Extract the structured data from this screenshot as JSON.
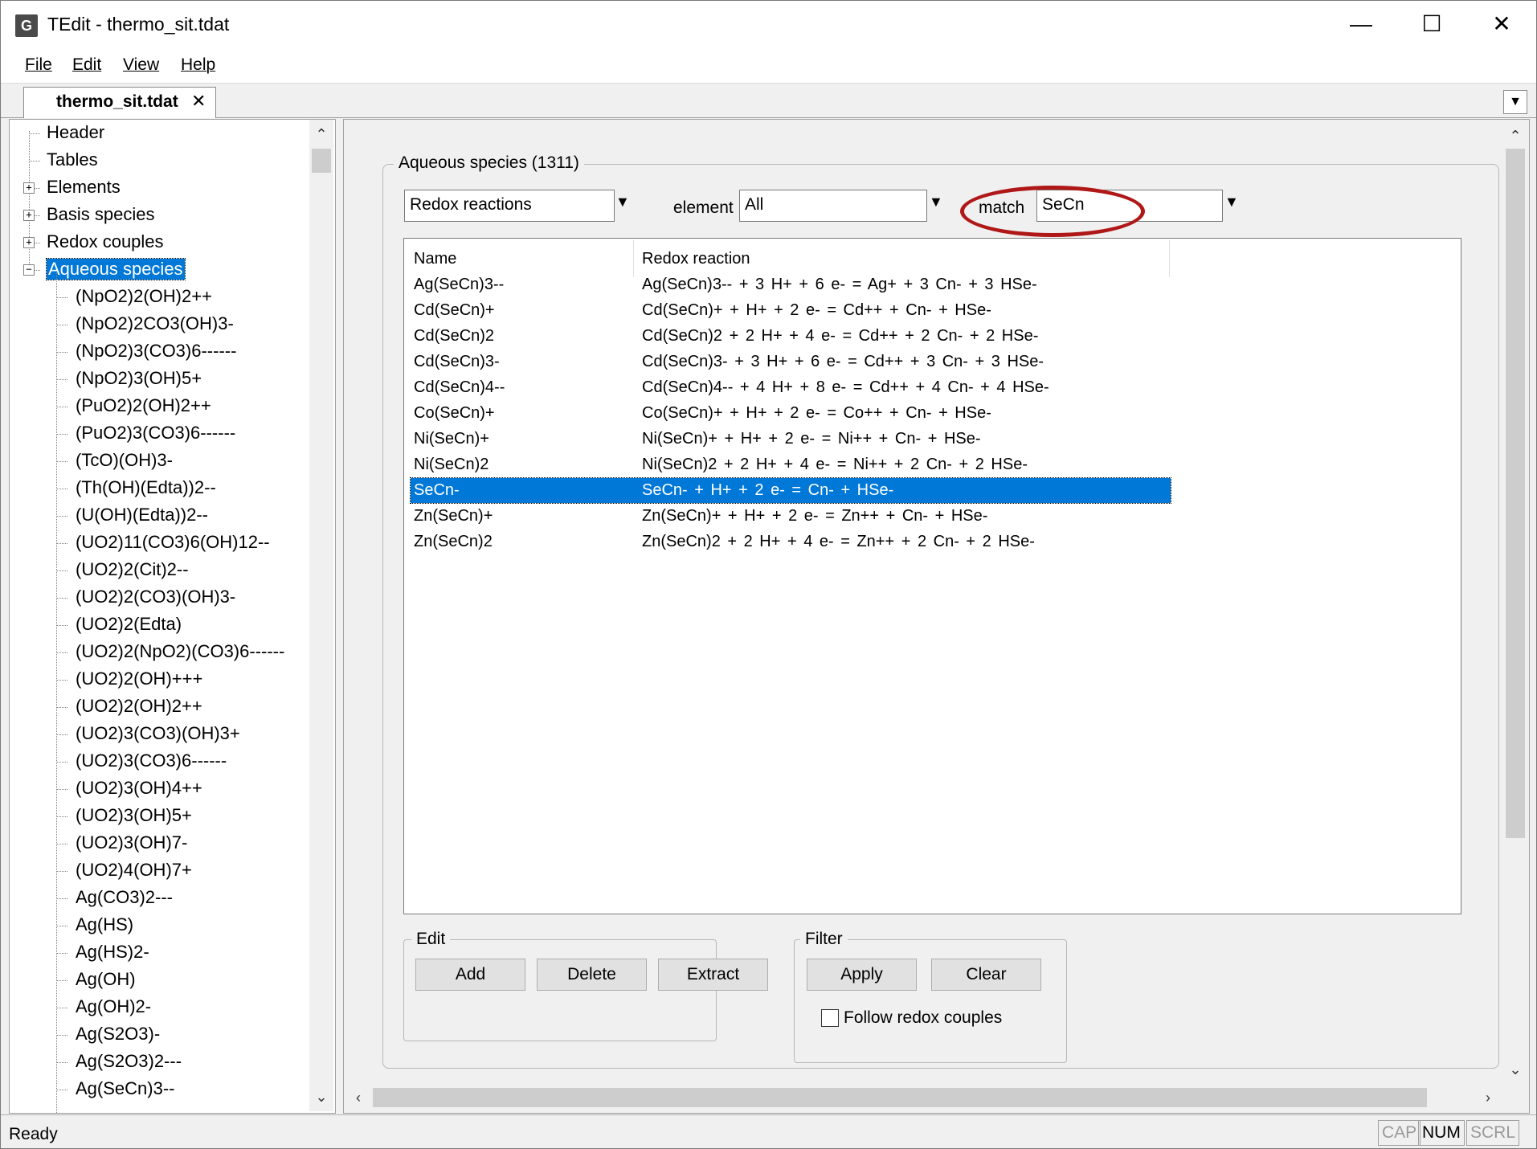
{
  "window": {
    "title": "TEdit - thermo_sit.tdat",
    "icon": "G",
    "minimize_glyph": "—",
    "maximize_glyph": "☐",
    "close_glyph": "✕"
  },
  "menu": [
    "File",
    "Edit",
    "View",
    "Help"
  ],
  "tab": {
    "label": "thermo_sit.tdat",
    "close_glyph": "✕"
  },
  "tree": {
    "top_items": [
      {
        "label": "Header",
        "expander": ""
      },
      {
        "label": "Tables",
        "expander": ""
      },
      {
        "label": "Elements",
        "expander": "+"
      },
      {
        "label": "Basis species",
        "expander": "+"
      },
      {
        "label": "Redox couples",
        "expander": "+"
      },
      {
        "label": "Aqueous species",
        "expander": "−",
        "selected": true
      }
    ],
    "children": [
      "(NpO2)2(OH)2++",
      "(NpO2)2CO3(OH)3-",
      "(NpO2)3(CO3)6------",
      "(NpO2)3(OH)5+",
      "(PuO2)2(OH)2++",
      "(PuO2)3(CO3)6------",
      "(TcO)(OH)3-",
      "(Th(OH)(Edta))2--",
      "(U(OH)(Edta))2--",
      "(UO2)11(CO3)6(OH)12--",
      "(UO2)2(Cit)2--",
      "(UO2)2(CO3)(OH)3-",
      "(UO2)2(Edta)",
      "(UO2)2(NpO2)(CO3)6------",
      "(UO2)2(OH)+++",
      "(UO2)2(OH)2++",
      "(UO2)3(CO3)(OH)3+",
      "(UO2)3(CO3)6------",
      "(UO2)3(OH)4++",
      "(UO2)3(OH)5+",
      "(UO2)3(OH)7-",
      "(UO2)4(OH)7+",
      "Ag(CO3)2---",
      "Ag(HS)",
      "Ag(HS)2-",
      "Ag(OH)",
      "Ag(OH)2-",
      "Ag(S2O3)-",
      "Ag(S2O3)2---",
      "Ag(SeCn)3--"
    ]
  },
  "panel": {
    "group_title": "Aqueous species (1311)",
    "view_combo": "Redox reactions",
    "element_label": "element",
    "element_combo": "All",
    "match_label": "match",
    "match_value": "SeCn",
    "highlight_color": "#b01818"
  },
  "table": {
    "columns": [
      "Name",
      "Redox reaction"
    ],
    "rows": [
      {
        "name": "Ag(SeCn)3--",
        "rxn": "Ag(SeCn)3-- + 3 H+ + 6 e- = Ag+ + 3 Cn- + 3 HSe-"
      },
      {
        "name": "Cd(SeCn)+",
        "rxn": "Cd(SeCn)+ + H+ + 2 e- = Cd++ + Cn- + HSe-"
      },
      {
        "name": "Cd(SeCn)2",
        "rxn": "Cd(SeCn)2 + 2 H+ + 4 e- = Cd++ + 2 Cn- + 2 HSe-"
      },
      {
        "name": "Cd(SeCn)3-",
        "rxn": "Cd(SeCn)3- + 3 H+ + 6 e- = Cd++ + 3 Cn- + 3 HSe-"
      },
      {
        "name": "Cd(SeCn)4--",
        "rxn": "Cd(SeCn)4-- + 4 H+ + 8 e- = Cd++ + 4 Cn- + 4 HSe-"
      },
      {
        "name": "Co(SeCn)+",
        "rxn": "Co(SeCn)+ + H+ + 2 e- = Co++ + Cn- + HSe-"
      },
      {
        "name": "Ni(SeCn)+",
        "rxn": "Ni(SeCn)+ + H+ + 2 e- = Ni++ + Cn- + HSe-"
      },
      {
        "name": "Ni(SeCn)2",
        "rxn": "Ni(SeCn)2 + 2 H+ + 4 e- = Ni++ + 2 Cn- + 2 HSe-"
      },
      {
        "name": "SeCn-",
        "rxn": "SeCn- + H+ + 2 e- = Cn- + HSe-",
        "selected": true
      },
      {
        "name": "Zn(SeCn)+",
        "rxn": "Zn(SeCn)+ + H+ + 2 e- = Zn++ + Cn- + HSe-"
      },
      {
        "name": "Zn(SeCn)2",
        "rxn": "Zn(SeCn)2 + 2 H+ + 4 e- = Zn++ + 2 Cn- + 2 HSe-"
      }
    ]
  },
  "edit_group": {
    "title": "Edit",
    "add": "Add",
    "delete": "Delete",
    "extract": "Extract"
  },
  "filter_group": {
    "title": "Filter",
    "apply": "Apply",
    "clear": "Clear",
    "follow_label": "Follow redox couples",
    "follow_checked": false
  },
  "status": {
    "text": "Ready",
    "cap": "CAP",
    "num": "NUM",
    "scrl": "SCRL"
  },
  "colors": {
    "selection": "#0078d7"
  }
}
